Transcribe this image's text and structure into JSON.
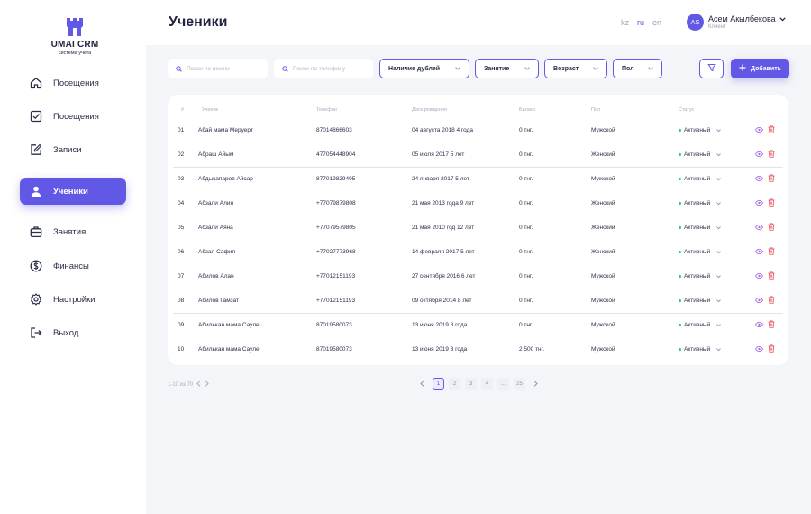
{
  "app": {
    "name": "UMAI CRM",
    "tagline": "система учета"
  },
  "sidebar": {
    "items": [
      {
        "label": "Посещения",
        "icon": "home-icon",
        "active": false
      },
      {
        "label": "Посещения",
        "icon": "checkbox-icon",
        "active": false
      },
      {
        "label": "Записи",
        "icon": "edit-icon",
        "active": false
      },
      {
        "label": "Ученики",
        "icon": "user-icon",
        "active": true
      },
      {
        "label": "Занятия",
        "icon": "briefcase-icon",
        "active": false
      },
      {
        "label": "Финансы",
        "icon": "dollar-icon",
        "active": false
      },
      {
        "label": "Настройки",
        "icon": "gear-icon",
        "active": false
      },
      {
        "label": "Выход",
        "icon": "logout-icon",
        "active": false
      }
    ]
  },
  "header": {
    "title": "Ученики",
    "languages": [
      "kz",
      "ru",
      "en"
    ],
    "active_language": "ru",
    "user": {
      "initials": "AS",
      "name": "Асем Акылбекова",
      "role": "Клиент"
    }
  },
  "filters": {
    "search_name_placeholder": "Поиск по имени",
    "search_phone_placeholder": "Поиск по телефону",
    "dropdowns": [
      "Наличие дублей",
      "Занятие",
      "Возраст",
      "Пол"
    ],
    "add_label": "Добавить"
  },
  "table": {
    "columns": [
      "#",
      "Ученик",
      "Телефон",
      "Дата рождения",
      "Баланс",
      "Пол",
      "Статус"
    ],
    "rows": [
      {
        "num": "01",
        "name": "Абай мама Меруерт",
        "phone": "87014866603",
        "birth": "04 августа 2018 4 года",
        "balance": "0 тнг.",
        "gender": "Мужской",
        "status": "Активный"
      },
      {
        "num": "02",
        "name": "Абраш Айым",
        "phone": "477054448904",
        "birth": "05 июля 2017 5 лет",
        "balance": "0 тнг.",
        "gender": "Женский",
        "status": "Активный"
      },
      {
        "num": "03",
        "name": "Абдыкапаров Айсар",
        "phone": "877019829495",
        "birth": "24 января 2017 5 лет",
        "balance": "0 тнг.",
        "gender": "Мужской",
        "status": "Активный"
      },
      {
        "num": "04",
        "name": "Абзали Алия",
        "phone": "+77079879808",
        "birth": "21 мая 2013 года 9 лет",
        "balance": "0 тнг.",
        "gender": "Женский",
        "status": "Активный"
      },
      {
        "num": "05",
        "name": "Абзали Аяна",
        "phone": "+77079579805",
        "birth": "21 мая 2010 год 12 лет",
        "balance": "0 тнг.",
        "gender": "Женский",
        "status": "Активный"
      },
      {
        "num": "06",
        "name": "Абзал Сафия",
        "phone": "+77027773968",
        "birth": "14 февраля 2017 5 лет",
        "balance": "0 тнг.",
        "gender": "Женский",
        "status": "Активный"
      },
      {
        "num": "07",
        "name": "Абилов Алан",
        "phone": "+77012151193",
        "birth": "27 сентября 2016 6 лет",
        "balance": "0 тнг.",
        "gender": "Мужской",
        "status": "Активный"
      },
      {
        "num": "08",
        "name": "Абилов Гамзат",
        "phone": "+77012151193",
        "birth": "09 октября 2014 8 лет",
        "balance": "0 тнг.",
        "gender": "Мужской",
        "status": "Активный"
      },
      {
        "num": "09",
        "name": "Абилькан мама Сауле",
        "phone": "87019580073",
        "birth": "13 июня 2019 3 года",
        "balance": "0 тнг.",
        "gender": "Мужской",
        "status": "Активный"
      },
      {
        "num": "10",
        "name": "Абилькан мама Сауле",
        "phone": "87019580073",
        "birth": "13 июня 2019 3 года",
        "balance": "2 500 тнг.",
        "gender": "Мужской",
        "status": "Активный"
      }
    ]
  },
  "pagination": {
    "range": "1-10 из 70",
    "pages": [
      "1",
      "2",
      "3",
      "4",
      "...",
      "25"
    ],
    "current": "1"
  },
  "colors": {
    "accent": "#6159e6",
    "status_active": "#2bc08a",
    "danger": "#e8606d",
    "view": "#a774e6"
  }
}
